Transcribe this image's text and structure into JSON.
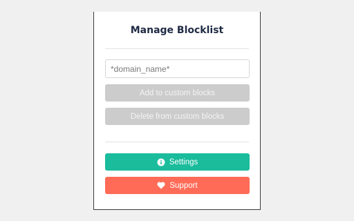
{
  "panel": {
    "title": "Manage Blocklist",
    "domain_input": {
      "placeholder": "*domain_name*",
      "value": ""
    },
    "add_button": "Add to custom blocks",
    "delete_button": "Delete from custom blocks",
    "settings_button": "Settings",
    "support_button": "Support"
  },
  "colors": {
    "background": "#f0f0f0",
    "panel": "#ffffff",
    "disabled_button": "#cccccc",
    "settings_button": "#1abc9c",
    "support_button": "#ff6b57",
    "title_text": "#1f2a44"
  },
  "icons": {
    "settings": "info-circle-icon",
    "support": "heart-icon"
  }
}
